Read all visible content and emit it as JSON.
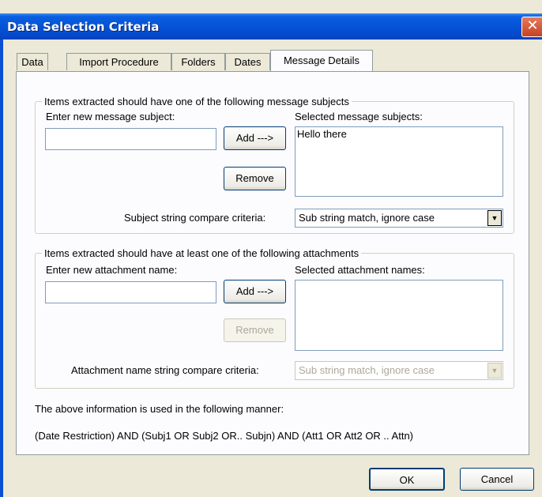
{
  "window": {
    "title": "Data Selection Criteria",
    "close_glyph": "✕"
  },
  "tabs": [
    {
      "label": "Data"
    },
    {
      "label": "Import Procedure"
    },
    {
      "label": "Folders"
    },
    {
      "label": "Dates"
    },
    {
      "label": "Message Details",
      "active": true
    }
  ],
  "subjects": {
    "group_title": "Items extracted should have one of the following message subjects",
    "enter_label": "Enter new message subject:",
    "input_value": "",
    "selected_label": "Selected message subjects:",
    "selected_items": [
      "Hello there"
    ],
    "add_label": "Add --->",
    "remove_label": "Remove",
    "compare_label": "Subject string compare criteria:",
    "compare_value": "Sub string match, ignore case"
  },
  "attachments": {
    "group_title": "Items extracted should have at least one of the following attachments",
    "enter_label": "Enter new attachment name:",
    "input_value": "",
    "selected_label": "Selected attachment names:",
    "selected_items": [],
    "add_label": "Add --->",
    "remove_label": "Remove",
    "compare_label": "Attachment name string compare criteria:",
    "compare_value": "Sub string match, ignore case"
  },
  "info": {
    "line1": "The above information is used in the following manner:",
    "line2": "(Date Restriction) AND (Subj1 OR Subj2 OR.. Subjn) AND (Att1 OR Att2 OR .. Attn)"
  },
  "buttons": {
    "ok": "OK",
    "cancel": "Cancel"
  },
  "icons": {
    "dropdown": "▼"
  }
}
